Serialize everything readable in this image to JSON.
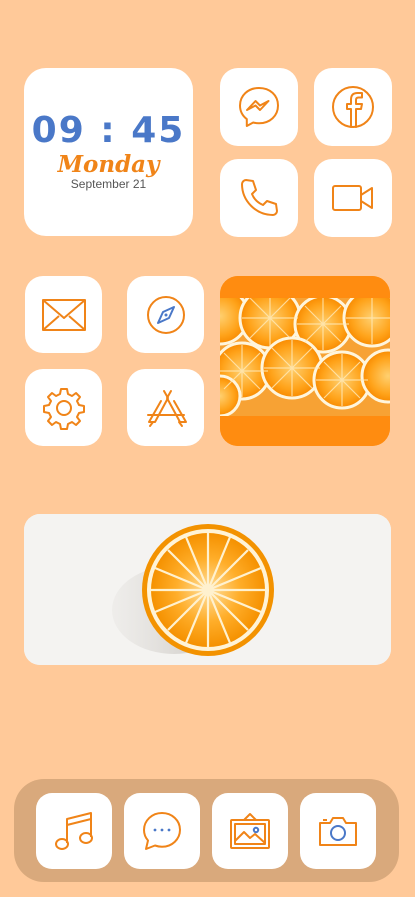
{
  "clock_widget": {
    "time": "09 : 45",
    "day": "Monday",
    "date": "September 21"
  },
  "apps": {
    "row1": [
      "messenger-icon",
      "facebook-icon"
    ],
    "row2": [
      "phone-icon",
      "video-camera-icon"
    ],
    "row3": [
      "mail-icon",
      "compass-icon"
    ],
    "row4": [
      "settings-gear-icon",
      "app-store-icon"
    ]
  },
  "dock": [
    "music-note-icon",
    "chat-bubble-icon",
    "gallery-icon",
    "camera-icon"
  ],
  "colors": {
    "background": "#FFC999",
    "accent": "#F08418",
    "clock_time": "#4A78C8",
    "dock_bg": "#D9A97C",
    "tile": "#FFFFFF"
  }
}
